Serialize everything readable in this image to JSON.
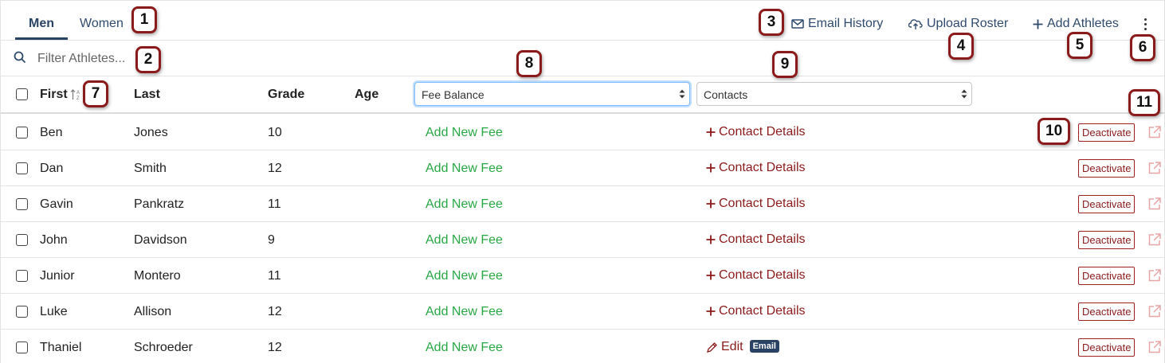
{
  "tabs": [
    {
      "label": "Men",
      "active": true
    },
    {
      "label": "Women",
      "active": false
    }
  ],
  "actions": {
    "email_history": "Email History",
    "upload_roster": "Upload Roster",
    "add_athletes": "Add Athletes"
  },
  "filter": {
    "placeholder": "Filter Athletes..."
  },
  "columns": {
    "first": "First",
    "last": "Last",
    "grade": "Grade",
    "age": "Age",
    "fee_select": "Fee Balance",
    "contacts_select": "Contacts"
  },
  "rows": [
    {
      "first": "Ben",
      "last": "Jones",
      "grade": "10",
      "fee": "Add New Fee",
      "contact": "Contact Details",
      "action": "Deactivate"
    },
    {
      "first": "Dan",
      "last": "Smith",
      "grade": "12",
      "fee": "Add New Fee",
      "contact": "Contact Details",
      "action": "Deactivate"
    },
    {
      "first": "Gavin",
      "last": "Pankratz",
      "grade": "11",
      "fee": "Add New Fee",
      "contact": "Contact Details",
      "action": "Deactivate"
    },
    {
      "first": "John",
      "last": "Davidson",
      "grade": "9",
      "fee": "Add New Fee",
      "contact": "Contact Details",
      "action": "Deactivate"
    },
    {
      "first": "Junior",
      "last": "Montero",
      "grade": "11",
      "fee": "Add New Fee",
      "contact": "Contact Details",
      "action": "Deactivate"
    },
    {
      "first": "Luke",
      "last": "Allison",
      "grade": "12",
      "fee": "Add New Fee",
      "contact": "Contact Details",
      "action": "Deactivate"
    },
    {
      "first": "Thaniel",
      "last": "Schroeder",
      "grade": "12",
      "fee": "Add New Fee",
      "contact": "Edit",
      "badge": "Email",
      "action": "Deactivate"
    }
  ],
  "callouts": [
    "1",
    "2",
    "3",
    "4",
    "5",
    "6",
    "7",
    "8",
    "9",
    "10",
    "11"
  ],
  "colors": {
    "brand": "#2a4365",
    "fee_green": "#28a745",
    "contact_red": "#8b1a1a",
    "callout_border": "#8b1a1a"
  }
}
